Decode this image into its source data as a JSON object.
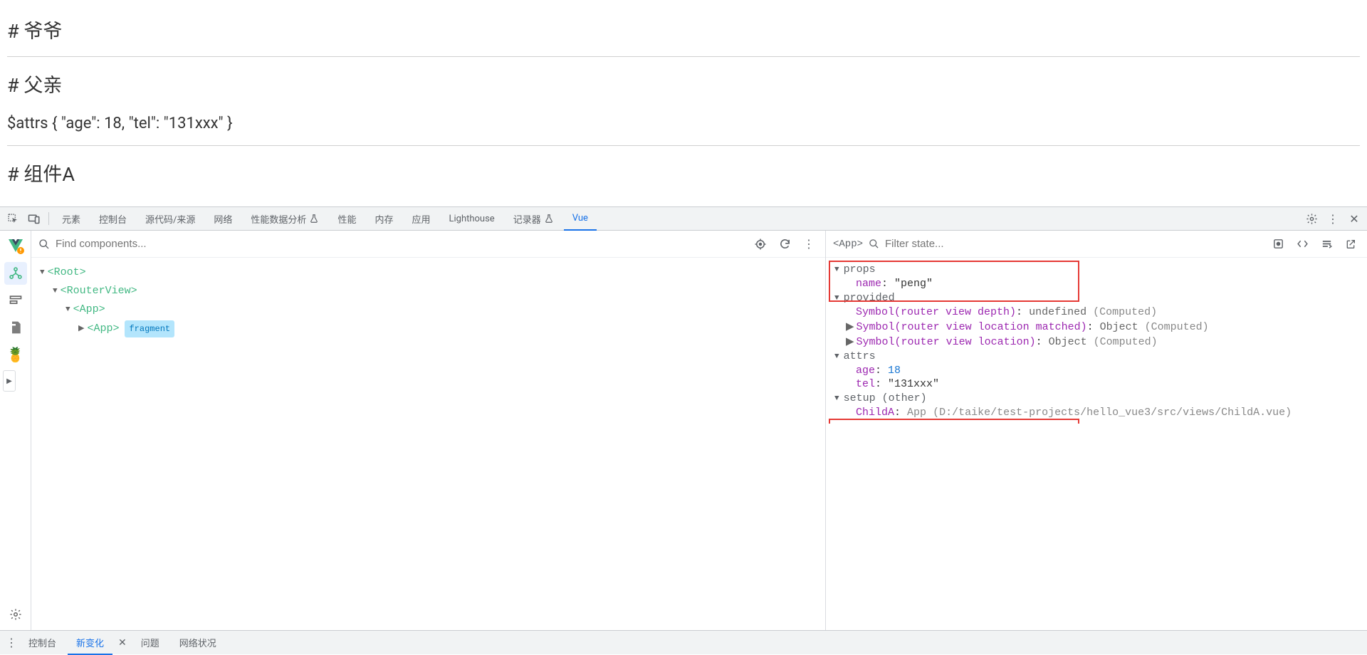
{
  "page": {
    "h1": "# 爷爷",
    "h2": "# 父亲",
    "attrs_line": "$attrs { \"age\": 18, \"tel\": \"131xxx\" }",
    "h3": "# 组件A"
  },
  "devtools": {
    "tabs": {
      "elements": "元素",
      "console": "控制台",
      "sources": "源代码/来源",
      "network": "网络",
      "performance_insights": "性能数据分析",
      "performance": "性能",
      "memory": "内存",
      "application": "应用",
      "lighthouse": "Lighthouse",
      "recorder": "记录器",
      "vue": "Vue"
    }
  },
  "components": {
    "search_placeholder": "Find components...",
    "tree": {
      "root": "<Root>",
      "router_view": "<RouterView>",
      "app1": "<App>",
      "app2": "<App>",
      "fragment_badge": "fragment"
    }
  },
  "state": {
    "filter_placeholder": "Filter state...",
    "crumb": "<App>",
    "props_label": "props",
    "props": {
      "name_key": "name",
      "name_val": "\"peng\""
    },
    "provided_label": "provided",
    "provided": {
      "k1": "Symbol(router view depth)",
      "v1": "undefined",
      "c1": "(Computed)",
      "k2": "Symbol(router view location matched)",
      "v2": "Object",
      "c2": "(Computed)",
      "k3": "Symbol(router view location)",
      "v3": "Object",
      "c3": "(Computed)"
    },
    "attrs_label": "attrs",
    "attrs": {
      "age_key": "age",
      "age_val": "18",
      "tel_key": "tel",
      "tel_val": "\"131xxx\""
    },
    "setup_label": "setup (other)",
    "setup": {
      "childa_key": "ChildA",
      "childa_val": "App",
      "childa_path": "(D:/taike/test-projects/hello_vue3/src/views/ChildA.vue)"
    }
  },
  "drawer": {
    "console": "控制台",
    "new_changes": "新变化",
    "issues": "问题",
    "network_conditions": "网络状况"
  }
}
